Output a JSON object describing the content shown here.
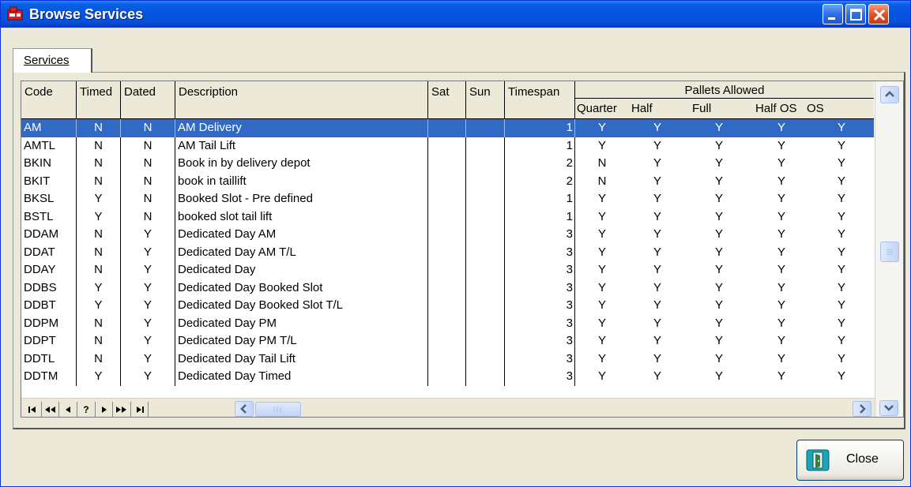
{
  "window": {
    "title": "Browse Services"
  },
  "tabs": [
    {
      "label": "Services"
    }
  ],
  "grid": {
    "columns": [
      "Code",
      "Timed",
      "Dated",
      "Description",
      "Sat",
      "Sun",
      "Timespan"
    ],
    "pallets_header": "Pallets Allowed",
    "pallets_subheaders": [
      "Quarter",
      "Half",
      "Full",
      "Half OS",
      "OS"
    ],
    "selected_row_index": 0,
    "rows": [
      {
        "code": "AM",
        "timed": "N",
        "dated": "N",
        "description": "AM Delivery",
        "sat": "",
        "sun": "",
        "timespan": "1",
        "pallets": [
          "Y",
          "Y",
          "Y",
          "Y",
          "Y"
        ]
      },
      {
        "code": "AMTL",
        "timed": "N",
        "dated": "N",
        "description": "AM Tail Lift",
        "sat": "",
        "sun": "",
        "timespan": "1",
        "pallets": [
          "Y",
          "Y",
          "Y",
          "Y",
          "Y"
        ]
      },
      {
        "code": "BKIN",
        "timed": "N",
        "dated": "N",
        "description": "Book in by delivery depot",
        "sat": "",
        "sun": "",
        "timespan": "2",
        "pallets": [
          "N",
          "Y",
          "Y",
          "Y",
          "Y"
        ]
      },
      {
        "code": "BKIT",
        "timed": "N",
        "dated": "N",
        "description": "book in taillift",
        "sat": "",
        "sun": "",
        "timespan": "2",
        "pallets": [
          "N",
          "Y",
          "Y",
          "Y",
          "Y"
        ]
      },
      {
        "code": "BKSL",
        "timed": "Y",
        "dated": "N",
        "description": "Booked Slot - Pre defined",
        "sat": "",
        "sun": "",
        "timespan": "1",
        "pallets": [
          "Y",
          "Y",
          "Y",
          "Y",
          "Y"
        ]
      },
      {
        "code": "BSTL",
        "timed": "Y",
        "dated": "N",
        "description": "booked slot tail lift",
        "sat": "",
        "sun": "",
        "timespan": "1",
        "pallets": [
          "Y",
          "Y",
          "Y",
          "Y",
          "Y"
        ]
      },
      {
        "code": "DDAM",
        "timed": "N",
        "dated": "Y",
        "description": "Dedicated Day AM",
        "sat": "",
        "sun": "",
        "timespan": "3",
        "pallets": [
          "Y",
          "Y",
          "Y",
          "Y",
          "Y"
        ]
      },
      {
        "code": "DDAT",
        "timed": "N",
        "dated": "Y",
        "description": "Dedicated Day AM T/L",
        "sat": "",
        "sun": "",
        "timespan": "3",
        "pallets": [
          "Y",
          "Y",
          "Y",
          "Y",
          "Y"
        ]
      },
      {
        "code": "DDAY",
        "timed": "N",
        "dated": "Y",
        "description": "Dedicated Day",
        "sat": "",
        "sun": "",
        "timespan": "3",
        "pallets": [
          "Y",
          "Y",
          "Y",
          "Y",
          "Y"
        ]
      },
      {
        "code": "DDBS",
        "timed": "Y",
        "dated": "Y",
        "description": "Dedicated Day Booked Slot",
        "sat": "",
        "sun": "",
        "timespan": "3",
        "pallets": [
          "Y",
          "Y",
          "Y",
          "Y",
          "Y"
        ]
      },
      {
        "code": "DDBT",
        "timed": "Y",
        "dated": "Y",
        "description": "Dedicated Day Booked Slot T/L",
        "sat": "",
        "sun": "",
        "timespan": "3",
        "pallets": [
          "Y",
          "Y",
          "Y",
          "Y",
          "Y"
        ]
      },
      {
        "code": "DDPM",
        "timed": "N",
        "dated": "Y",
        "description": "Dedicated Day PM",
        "sat": "",
        "sun": "",
        "timespan": "3",
        "pallets": [
          "Y",
          "Y",
          "Y",
          "Y",
          "Y"
        ]
      },
      {
        "code": "DDPT",
        "timed": "N",
        "dated": "Y",
        "description": "Dedicated Day PM T/L",
        "sat": "",
        "sun": "",
        "timespan": "3",
        "pallets": [
          "Y",
          "Y",
          "Y",
          "Y",
          "Y"
        ]
      },
      {
        "code": "DDTL",
        "timed": "N",
        "dated": "Y",
        "description": "Dedicated Day Tail Lift",
        "sat": "",
        "sun": "",
        "timespan": "3",
        "pallets": [
          "Y",
          "Y",
          "Y",
          "Y",
          "Y"
        ]
      },
      {
        "code": "DDTM",
        "timed": "Y",
        "dated": "Y",
        "description": "Dedicated Day Timed",
        "sat": "",
        "sun": "",
        "timespan": "3",
        "pallets": [
          "Y",
          "Y",
          "Y",
          "Y",
          "Y"
        ]
      }
    ]
  },
  "navigator": {
    "buttons": [
      {
        "name": "first-record",
        "glyph": "I◂◂"
      },
      {
        "name": "prior-page",
        "glyph": "◂◂"
      },
      {
        "name": "prior-record",
        "glyph": "◂"
      },
      {
        "name": "search",
        "glyph": "?"
      },
      {
        "name": "next-record",
        "glyph": "▸"
      },
      {
        "name": "next-page",
        "glyph": "▸▸"
      },
      {
        "name": "last-record",
        "glyph": "▸▸I"
      }
    ]
  },
  "close_button": {
    "label": "Close"
  },
  "colors": {
    "selection": "#316ac5",
    "titlebar": "#0555e0",
    "dialog_bg": "#ece9d8"
  },
  "icons": [
    "app-icon",
    "minimize-icon",
    "maximize-icon",
    "close-window-icon",
    "door-exit-icon",
    "scroll-up-icon",
    "scroll-down-icon",
    "scroll-left-icon",
    "scroll-right-icon"
  ]
}
